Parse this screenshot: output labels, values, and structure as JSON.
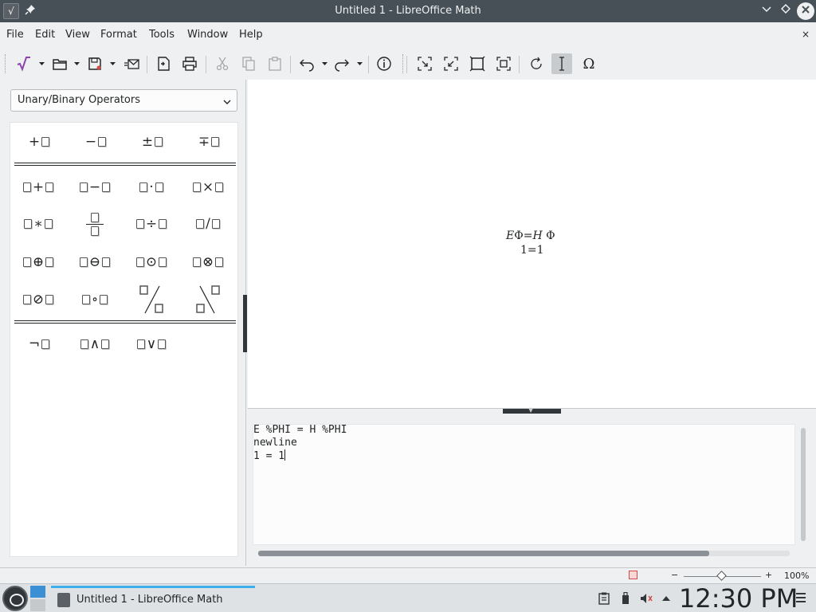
{
  "window": {
    "title": "Untitled 1 - LibreOffice Math",
    "doc_close_glyph": "×"
  },
  "menu": [
    "File",
    "Edit",
    "View",
    "Format",
    "Tools",
    "Window",
    "Help"
  ],
  "toolbar_icons": [
    "formula-icon",
    "open-icon",
    "save-icon",
    "export-mail-icon",
    "export-pdf-icon",
    "print-icon",
    "cut-icon",
    "copy-icon",
    "paste-icon",
    "undo-icon",
    "redo-icon",
    "info-icon",
    "zoom-in-icon",
    "zoom-out-icon",
    "show-all-icon",
    "zoom-100-icon",
    "update-icon",
    "formula-cursor-icon",
    "symbols-omega-icon"
  ],
  "elements": {
    "category": "Unary/Binary Operators",
    "unary": [
      "+",
      "−",
      "±",
      "∓"
    ],
    "binary_row1": [
      "+",
      "−",
      "·",
      "×"
    ],
    "binary_row2": [
      "∗",
      "÷",
      "/"
    ],
    "binary_row3": [
      "⊕",
      "⊖",
      "⊙",
      "⊗"
    ],
    "binary_row4": [
      "⊘",
      "∘"
    ],
    "logic": [
      "¬",
      "∧",
      "∨"
    ]
  },
  "preview": {
    "line1": [
      "E",
      "Φ",
      "=",
      "H",
      "Φ"
    ],
    "line2": "1=1"
  },
  "command": {
    "lines": [
      "E %PHI = H %PHI",
      "newline",
      "1 = 1"
    ]
  },
  "status": {
    "zoom": "100%",
    "zoom_minus": "−",
    "zoom_plus": "+"
  },
  "taskbar": {
    "task_label": "Untitled 1 - LibreOffice Math",
    "clock": "12:30 PM"
  },
  "colors": {
    "titlebar": "#475057",
    "accent": "#3daee9",
    "panel_bg": "#eff0f1"
  }
}
